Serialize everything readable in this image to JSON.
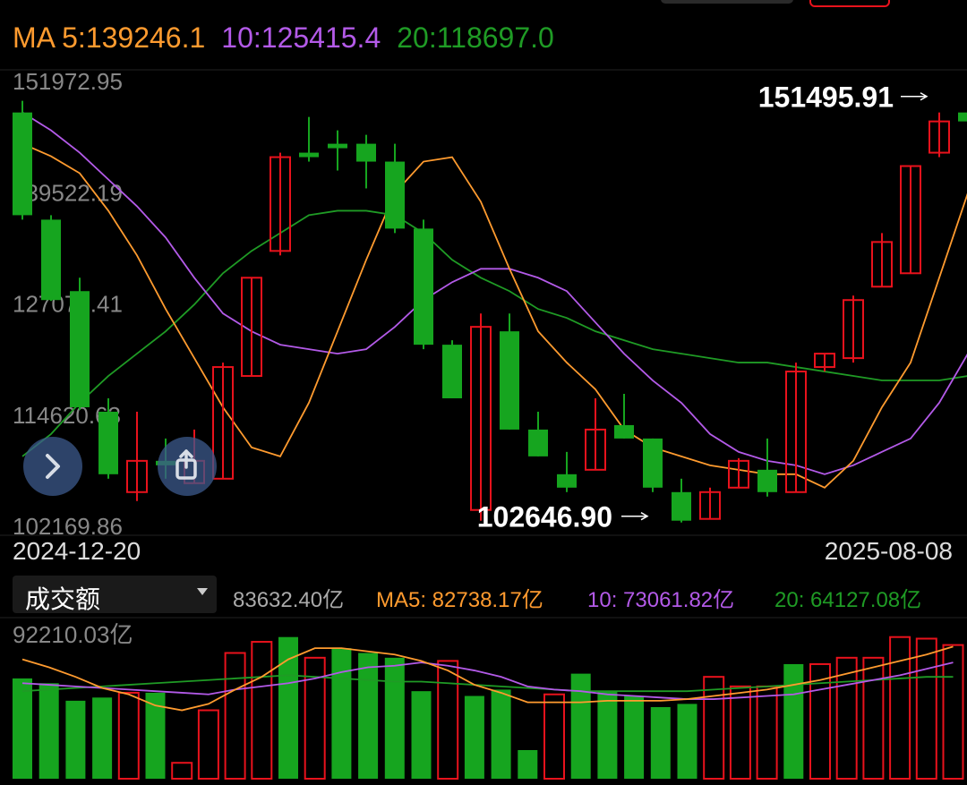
{
  "legend": {
    "ma5": "MA 5:139246.1",
    "ma10": "10:125415.4",
    "ma20": "20:118697.0"
  },
  "dates": {
    "start": "2024-12-20",
    "end": "2025-08-08"
  },
  "volume_panel": {
    "selector_label": "成交额",
    "current": "83632.40亿",
    "ma5": "MA5: 82738.17亿",
    "ma10": "10: 73061.82亿",
    "ma20": "20: 64127.08亿",
    "axis_top": "92210.03亿"
  },
  "colors": {
    "up": "#e8121c",
    "down": "#16a51f",
    "ma5": "#ff9b2f",
    "ma10": "#b35ae8",
    "ma20": "#1f9b25"
  },
  "chart_data": {
    "type": "candlestick",
    "y_ticks": [
      "151972.95",
      "139522.19",
      "127071.41",
      "114620.63",
      "102169.86"
    ],
    "ylim": [
      102169.86,
      151972.95
    ],
    "annotations": {
      "high_label": "151495.91",
      "low_label": "102646.90"
    },
    "candles": [
      {
        "open": 148500,
        "high": 149800,
        "close": 137000,
        "low": 136500
      },
      {
        "open": 136500,
        "high": 137000,
        "close": 127500,
        "low": 127400
      },
      {
        "open": 128500,
        "high": 130000,
        "close": 115500,
        "low": 115200
      },
      {
        "open": 115000,
        "high": 116500,
        "close": 108000,
        "low": 107500
      },
      {
        "open": 106000,
        "high": 115000,
        "close": 109500,
        "low": 105000
      },
      {
        "open": 109500,
        "high": 112000,
        "close": 109000,
        "low": 107500
      },
      {
        "open": 107000,
        "high": 113000,
        "close": 109500,
        "low": 107000
      },
      {
        "open": 107500,
        "high": 120500,
        "close": 120000,
        "low": 107500
      },
      {
        "open": 119000,
        "high": 130000,
        "close": 130000,
        "low": 119000
      },
      {
        "open": 133000,
        "high": 144000,
        "close": 143500,
        "low": 132500
      },
      {
        "open": 144000,
        "high": 148000,
        "close": 143500,
        "low": 143000
      },
      {
        "open": 145000,
        "high": 146500,
        "close": 144500,
        "low": 142000
      },
      {
        "open": 145000,
        "high": 146000,
        "close": 143000,
        "low": 140000
      },
      {
        "open": 143000,
        "high": 145000,
        "close": 135500,
        "low": 135000
      },
      {
        "open": 135500,
        "high": 136500,
        "close": 122500,
        "low": 122000
      },
      {
        "open": 122500,
        "high": 123000,
        "close": 116500,
        "low": 116500
      },
      {
        "open": 104000,
        "high": 126000,
        "close": 124500,
        "low": 102800
      },
      {
        "open": 124000,
        "high": 126000,
        "close": 113000,
        "low": 113000
      },
      {
        "open": 113000,
        "high": 115000,
        "close": 110000,
        "low": 110000
      },
      {
        "open": 108000,
        "high": 110500,
        "close": 106500,
        "low": 106000
      },
      {
        "open": 108500,
        "high": 116500,
        "close": 113000,
        "low": 108500
      },
      {
        "open": 113500,
        "high": 117000,
        "close": 112000,
        "low": 112000
      },
      {
        "open": 112000,
        "high": 112000,
        "close": 106500,
        "low": 106000
      },
      {
        "open": 106000,
        "high": 107500,
        "close": 102800,
        "low": 102600
      },
      {
        "open": 103000,
        "high": 106500,
        "close": 106000,
        "low": 103000
      },
      {
        "open": 106500,
        "high": 109800,
        "close": 109500,
        "low": 106500
      },
      {
        "open": 108500,
        "high": 112000,
        "close": 106000,
        "low": 105500
      },
      {
        "open": 106000,
        "high": 120500,
        "close": 119500,
        "low": 106000
      },
      {
        "open": 120000,
        "high": 121500,
        "close": 121500,
        "low": 119500
      },
      {
        "open": 121000,
        "high": 128000,
        "close": 127500,
        "low": 120500
      },
      {
        "open": 129000,
        "high": 135000,
        "close": 134000,
        "low": 129000
      },
      {
        "open": 130500,
        "high": 142500,
        "close": 142500,
        "low": 130500
      },
      {
        "open": 144000,
        "high": 148500,
        "close": 147500,
        "low": 143500
      },
      {
        "open": 148500,
        "high": 151300,
        "close": 147500,
        "low": 147000
      }
    ],
    "ma5_values": [
      145000,
      143600,
      141700,
      137500,
      132500,
      126500,
      121000,
      115500,
      111000,
      110000,
      116000,
      124000,
      132000,
      139500,
      143000,
      143500,
      138500,
      131000,
      124000,
      120500,
      117500,
      113000,
      111000,
      110000,
      109000,
      108500,
      108000,
      108000,
      106500,
      109500,
      115500,
      120500,
      130000,
      139500
    ],
    "ma10_values": [
      148500,
      146500,
      144000,
      141000,
      138000,
      134500,
      130000,
      126000,
      124000,
      122500,
      122000,
      121500,
      122000,
      124500,
      127500,
      129500,
      131000,
      131000,
      130000,
      128500,
      125000,
      121500,
      118500,
      116000,
      112500,
      110500,
      109500,
      109000,
      108000,
      109000,
      110500,
      112000,
      116000,
      121500
    ],
    "ma20_values": [
      110000,
      112500,
      116000,
      119000,
      121500,
      124000,
      127000,
      130500,
      133000,
      135000,
      137000,
      137500,
      137500,
      137000,
      135000,
      132000,
      130000,
      128500,
      126500,
      125500,
      124000,
      123000,
      122000,
      121500,
      121000,
      120500,
      120500,
      120000,
      119500,
      119000,
      118500,
      118500,
      118500,
      119000
    ],
    "volume": {
      "unit": "亿",
      "ylim": [
        0,
        92210.03
      ],
      "values": [
        63000,
        60000,
        49000,
        51000,
        54000,
        54000,
        10000,
        43000,
        79000,
        86000,
        89000,
        76000,
        82000,
        79000,
        76000,
        55000,
        74000,
        52000,
        56000,
        18000,
        53000,
        66000,
        55000,
        52000,
        45000,
        47000,
        64000,
        58000,
        58000,
        72000,
        72000,
        76000,
        76000,
        89000,
        88000,
        84000
      ],
      "ma5_values": [
        75000,
        70000,
        64000,
        57000,
        53000,
        46000,
        43000,
        47000,
        56000,
        64000,
        75000,
        82000,
        82000,
        80000,
        78000,
        74000,
        68000,
        59000,
        54000,
        48000,
        48000,
        48000,
        49000,
        49000,
        49000,
        50000,
        52000,
        54000,
        56000,
        59000,
        62000,
        66000,
        70000,
        74000,
        78000,
        83000
      ],
      "ma10_values": [
        60000,
        59000,
        58000,
        57000,
        56000,
        55000,
        54000,
        53000,
        56000,
        58000,
        60000,
        63000,
        67000,
        70000,
        71000,
        73000,
        71000,
        68000,
        64000,
        58000,
        56000,
        55000,
        53000,
        52000,
        51000,
        50000,
        50000,
        51000,
        52000,
        53000,
        56000,
        59000,
        62000,
        65000,
        69000,
        73000
      ],
      "ma20_values": [
        55000,
        56000,
        57000,
        58000,
        59000,
        60000,
        61000,
        62000,
        63000,
        64000,
        65000,
        64000,
        63000,
        62000,
        61000,
        61000,
        60000,
        59000,
        58000,
        57000,
        56000,
        55000,
        55000,
        55000,
        55000,
        55000,
        56000,
        57000,
        58000,
        59000,
        60000,
        61000,
        62000,
        63000,
        64000,
        64000
      ]
    }
  }
}
